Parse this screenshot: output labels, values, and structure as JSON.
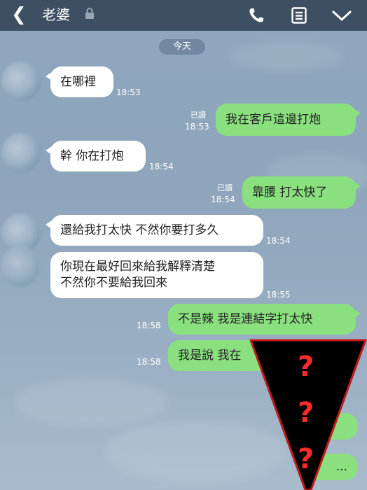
{
  "header": {
    "back_icon": "chevron-left-icon",
    "title": "老婆",
    "lock_icon": "lock-icon",
    "call_icon": "phone-icon",
    "notes_icon": "notes-icon",
    "menu_icon": "chevron-down-icon"
  },
  "date_label": "今天",
  "messages": [
    {
      "side": "in",
      "text": "在哪裡",
      "time": "18:53"
    },
    {
      "side": "out",
      "text": "我在客戶這邊打炮",
      "read": "已讀",
      "time": "18:53"
    },
    {
      "side": "in",
      "text": "幹 你在打炮",
      "time": "18:54"
    },
    {
      "side": "out",
      "text": "靠腰 打太快了",
      "read": "已讀",
      "time": "18:54"
    },
    {
      "side": "in",
      "text": "還給我打太快 不然你要打多久",
      "time": "18:54"
    },
    {
      "side": "in",
      "lines": [
        "你現在最好回來給我解釋清楚",
        "不然你不要給我回來"
      ],
      "time": "18:55"
    },
    {
      "side": "out",
      "text": "不是辣 我是連結字打太快",
      "time": "18:58"
    },
    {
      "side": "out",
      "text": "我是說 我在",
      "time": "18:58"
    }
  ],
  "overlay": {
    "marks": [
      "?",
      "?",
      "?"
    ],
    "hidden_tail": "..."
  },
  "colors": {
    "header_bg": "#3f4f63",
    "outgoing_bubble": "#8ae07f",
    "incoming_bubble": "#ffffff",
    "question_mark": "#ff2b2b"
  }
}
